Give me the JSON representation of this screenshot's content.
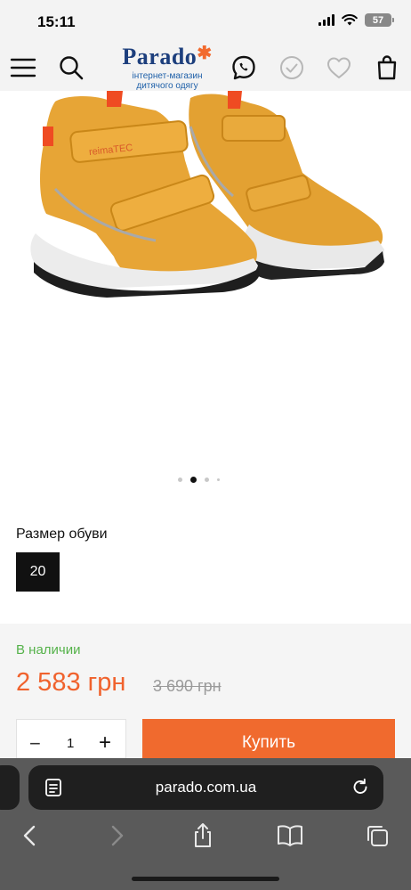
{
  "status_bar": {
    "time": "15:11",
    "battery": "57",
    "icons": [
      "signal-icon",
      "wifi-icon",
      "battery-icon"
    ]
  },
  "header": {
    "logo_word": "Parado",
    "logo_star": "✱",
    "logo_sub_line1": "інтернет-магазин",
    "logo_sub_line2": "дитячого одягу",
    "icons": [
      "menu-icon",
      "search-icon",
      "viber-icon",
      "check-icon",
      "heart-icon",
      "bag-icon"
    ],
    "brand_color": "#1d3f7d",
    "accent_color": "#f26a2e"
  },
  "product": {
    "image_description_icon": "product-photo-yellow-boots",
    "boot_brand_text": "reimaTEC",
    "carousel": {
      "count": 4,
      "active_index": 1
    },
    "size_label": "Размер обуви",
    "selected_size": "20",
    "availability": "В наличии",
    "price": "2 583 грн",
    "old_price": "3 690 грн",
    "quantity": "1",
    "qty_minus": "−",
    "qty_plus": "+",
    "buy_label": "Купить",
    "buy_color": "#f06a2e",
    "price_color": "#f0622d",
    "availability_color": "#55b24a"
  },
  "browser": {
    "url": "parado.com.ua",
    "icons": [
      "reader-icon",
      "reload-icon",
      "back-icon",
      "forward-icon",
      "share-icon",
      "bookmarks-icon",
      "tabs-icon"
    ]
  }
}
